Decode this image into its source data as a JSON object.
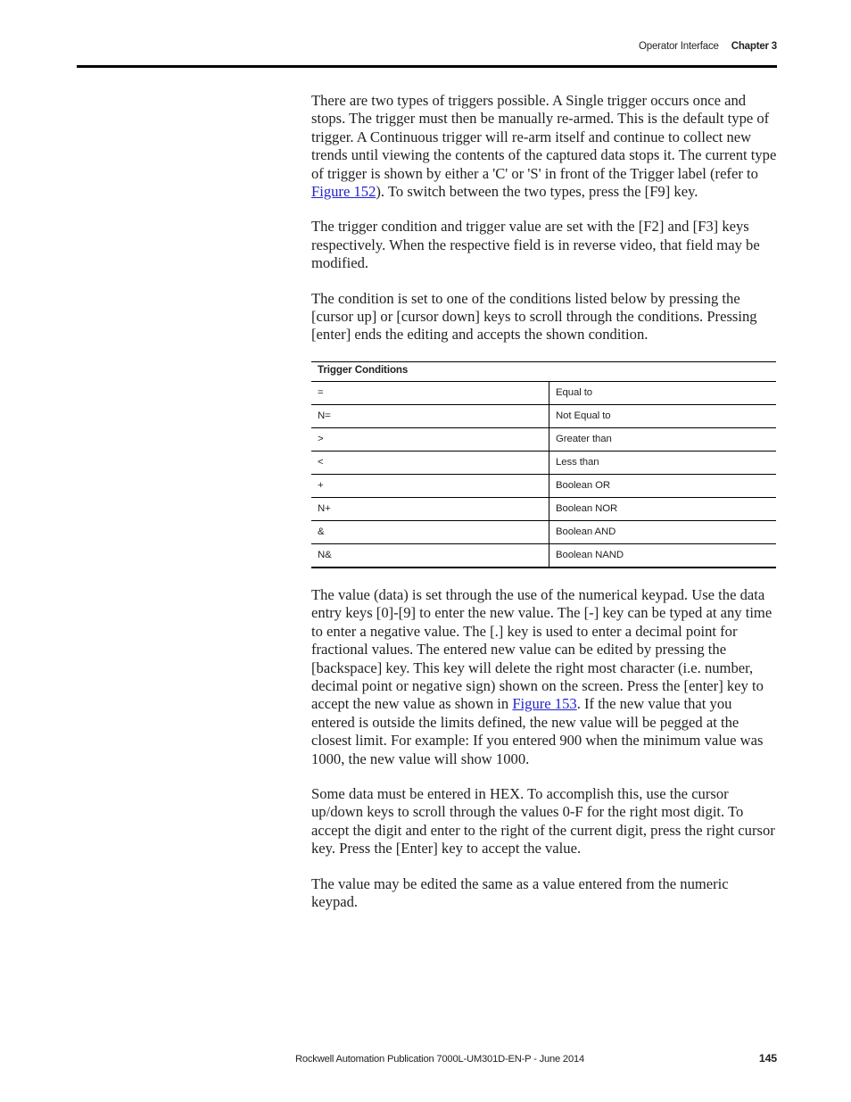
{
  "header": {
    "section": "Operator Interface",
    "chapter": "Chapter 3"
  },
  "body": {
    "p1_part1": "There are two types of triggers possible. A Single trigger occurs once and stops. The trigger must then be manually re-armed. This is the default type of trigger. A Continuous trigger will re-arm itself and continue to collect new trends until viewing the contents of the captured data stops it. The current type of trigger is shown by either a 'C' or 'S' in front of the Trigger label (refer to ",
    "p1_link": "Figure 152",
    "p1_part2": "). To switch between the two types, press the [F9] key.",
    "p2": "The trigger condition and trigger value are set with the [F2] and [F3] keys respectively. When the respective field is in reverse video, that field may be modified.",
    "p3": "The condition is set to one of the conditions listed below by pressing the [cursor up] or [cursor down] keys to scroll through the conditions. Pressing [enter] ends the editing and accepts the shown condition.",
    "p4_part1": "The value (data) is set through the use of the numerical keypad. Use the data entry keys [0]-[9] to enter the new value. The [-] key can be typed at any time to enter a negative value. The [.] key is used to enter a decimal point for fractional values. The entered new value can be edited by pressing the [backspace] key. This key will delete the right most character (i.e. number, decimal point or negative sign) shown on the screen. Press the [enter] key to accept the new value as shown in ",
    "p4_link": "Figure 153",
    "p4_part2": ". If the new value that you entered is outside the limits defined, the new value will be pegged at the closest limit. For example: If you entered 900 when the minimum value was 1000, the new value will show 1000.",
    "p5": "Some data must be entered in HEX. To accomplish this, use the cursor up/down keys to scroll through the values 0-F for the right most digit. To accept the digit and enter to the right of the current digit, press the right cursor key. Press the [Enter] key to accept the value.",
    "p6": "The value may be edited the same as a value entered from the numeric keypad."
  },
  "table": {
    "title": "Trigger Conditions",
    "rows": [
      {
        "symbol": "=",
        "meaning": "Equal to"
      },
      {
        "symbol": "N=",
        "meaning": "Not Equal to"
      },
      {
        "symbol": ">",
        "meaning": "Greater than"
      },
      {
        "symbol": "<",
        "meaning": "Less than"
      },
      {
        "symbol": "+",
        "meaning": "Boolean OR"
      },
      {
        "symbol": "N+",
        "meaning": "Boolean NOR"
      },
      {
        "symbol": "&",
        "meaning": "Boolean AND"
      },
      {
        "symbol": "N&",
        "meaning": "Boolean NAND"
      }
    ]
  },
  "footer": {
    "publication": "Rockwell Automation Publication 7000L-UM301D-EN-P - June 2014",
    "page_number": "145"
  },
  "colors": {
    "link": "#2222CC",
    "text": "#231F20",
    "rule": "#000000"
  }
}
